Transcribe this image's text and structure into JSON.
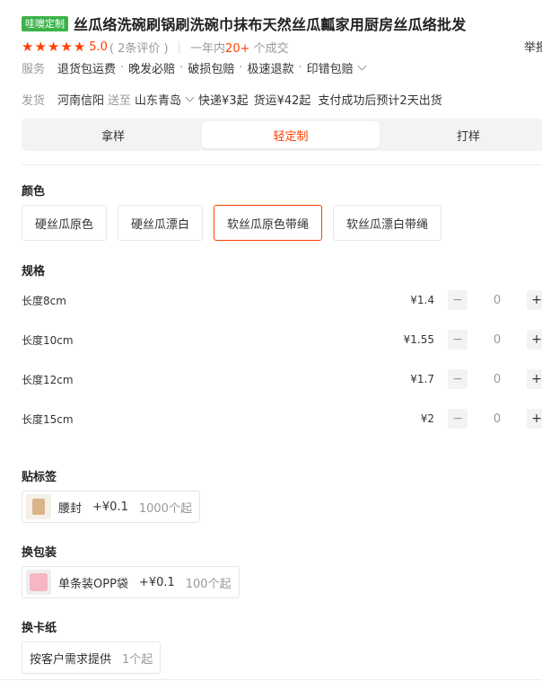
{
  "header": {
    "badge": "哇噢定制",
    "title": "丝瓜络洗碗刷锅刷洗碗巾抹布天然丝瓜瓤家用厨房丝瓜络批发",
    "rating_score": "5.0",
    "reviews": "( 2条评价 )",
    "sold_prefix": "一年内",
    "sold_count": "20+",
    "sold_suffix": "个成交",
    "report": "举报"
  },
  "service": {
    "label": "服务",
    "items": [
      "退货包运费",
      "晚发必赔",
      "破损包赔",
      "极速退款",
      "印错包赔"
    ]
  },
  "shipping": {
    "label": "发货",
    "from": "河南信阳",
    "to_word": "送至",
    "dest": "山东青岛",
    "express": "快递¥3起",
    "freight": "货运¥42起",
    "eta": "支付成功后预计2天出货"
  },
  "mode_tabs": [
    "拿样",
    "轻定制",
    "打样"
  ],
  "mode_active_index": 1,
  "color": {
    "title": "颜色",
    "options": [
      "硬丝瓜原色",
      "硬丝瓜漂白",
      "软丝瓜原色带绳",
      "软丝瓜漂白带绳"
    ],
    "selected_index": 2
  },
  "spec": {
    "title": "规格",
    "rows": [
      {
        "name": "长度8cm",
        "price": "¥1.4",
        "qty": "0"
      },
      {
        "name": "长度10cm",
        "price": "¥1.55",
        "qty": "0"
      },
      {
        "name": "长度12cm",
        "price": "¥1.7",
        "qty": "0"
      },
      {
        "name": "长度15cm",
        "price": "¥2",
        "qty": "0"
      }
    ],
    "minus": "−",
    "plus": "+"
  },
  "label_section": {
    "title": "贴标签",
    "item": {
      "name": "腰封",
      "price": "+¥0.1",
      "moq": "1000个起"
    }
  },
  "package_section": {
    "title": "换包装",
    "item": {
      "name": "单条装OPP袋",
      "price": "+¥0.1",
      "moq": "100个起"
    }
  },
  "card_section": {
    "title": "换卡纸",
    "item": {
      "name": "按客户需求提供",
      "moq": "1个起"
    }
  },
  "colors": {
    "accent": "#ff4000",
    "badge_green": "#3bb34a"
  }
}
